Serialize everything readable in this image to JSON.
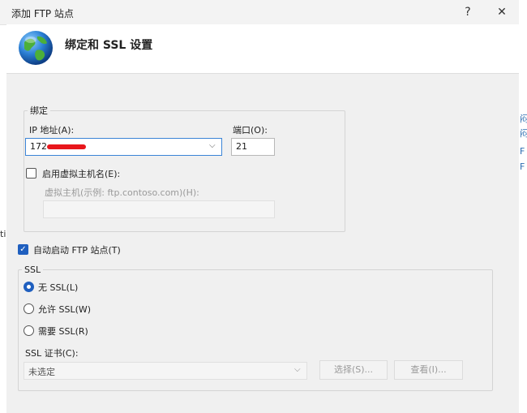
{
  "window": {
    "title": "添加 FTP 站点",
    "help_glyph": "?",
    "close_glyph": "✕"
  },
  "header": {
    "title": "绑定和 SSL 设置",
    "icon": "globe-icon"
  },
  "binding": {
    "group_label": "绑定",
    "ip_label": "IP 地址(A):",
    "ip_value": "172",
    "port_label": "端口(O):",
    "port_value": "21",
    "virtual_host_enable_label": "启用虚拟主机名(E):",
    "virtual_host_enabled": false,
    "virtual_host_label": "虚拟主机(示例: ftp.contoso.com)(H):",
    "virtual_host_value": ""
  },
  "auto_start": {
    "label": "自动启动 FTP 站点(T)",
    "checked": true
  },
  "ssl": {
    "group_label": "SSL",
    "options": [
      {
        "label": "无 SSL(L)",
        "selected": true
      },
      {
        "label": "允许 SSL(W)",
        "selected": false
      },
      {
        "label": "需要 SSL(R)",
        "selected": false
      }
    ],
    "cert_label": "SSL 证书(C):",
    "cert_value": "未选定",
    "select_button": "选择(S)...",
    "view_button": "查看(I)..."
  },
  "background": {
    "right_links": [
      "闷",
      "闷",
      "F",
      "F"
    ],
    "left_fragment": "ti"
  },
  "colors": {
    "accent": "#1f5fbf",
    "focus_border": "#3b84d6",
    "redaction": "#e8161b"
  }
}
